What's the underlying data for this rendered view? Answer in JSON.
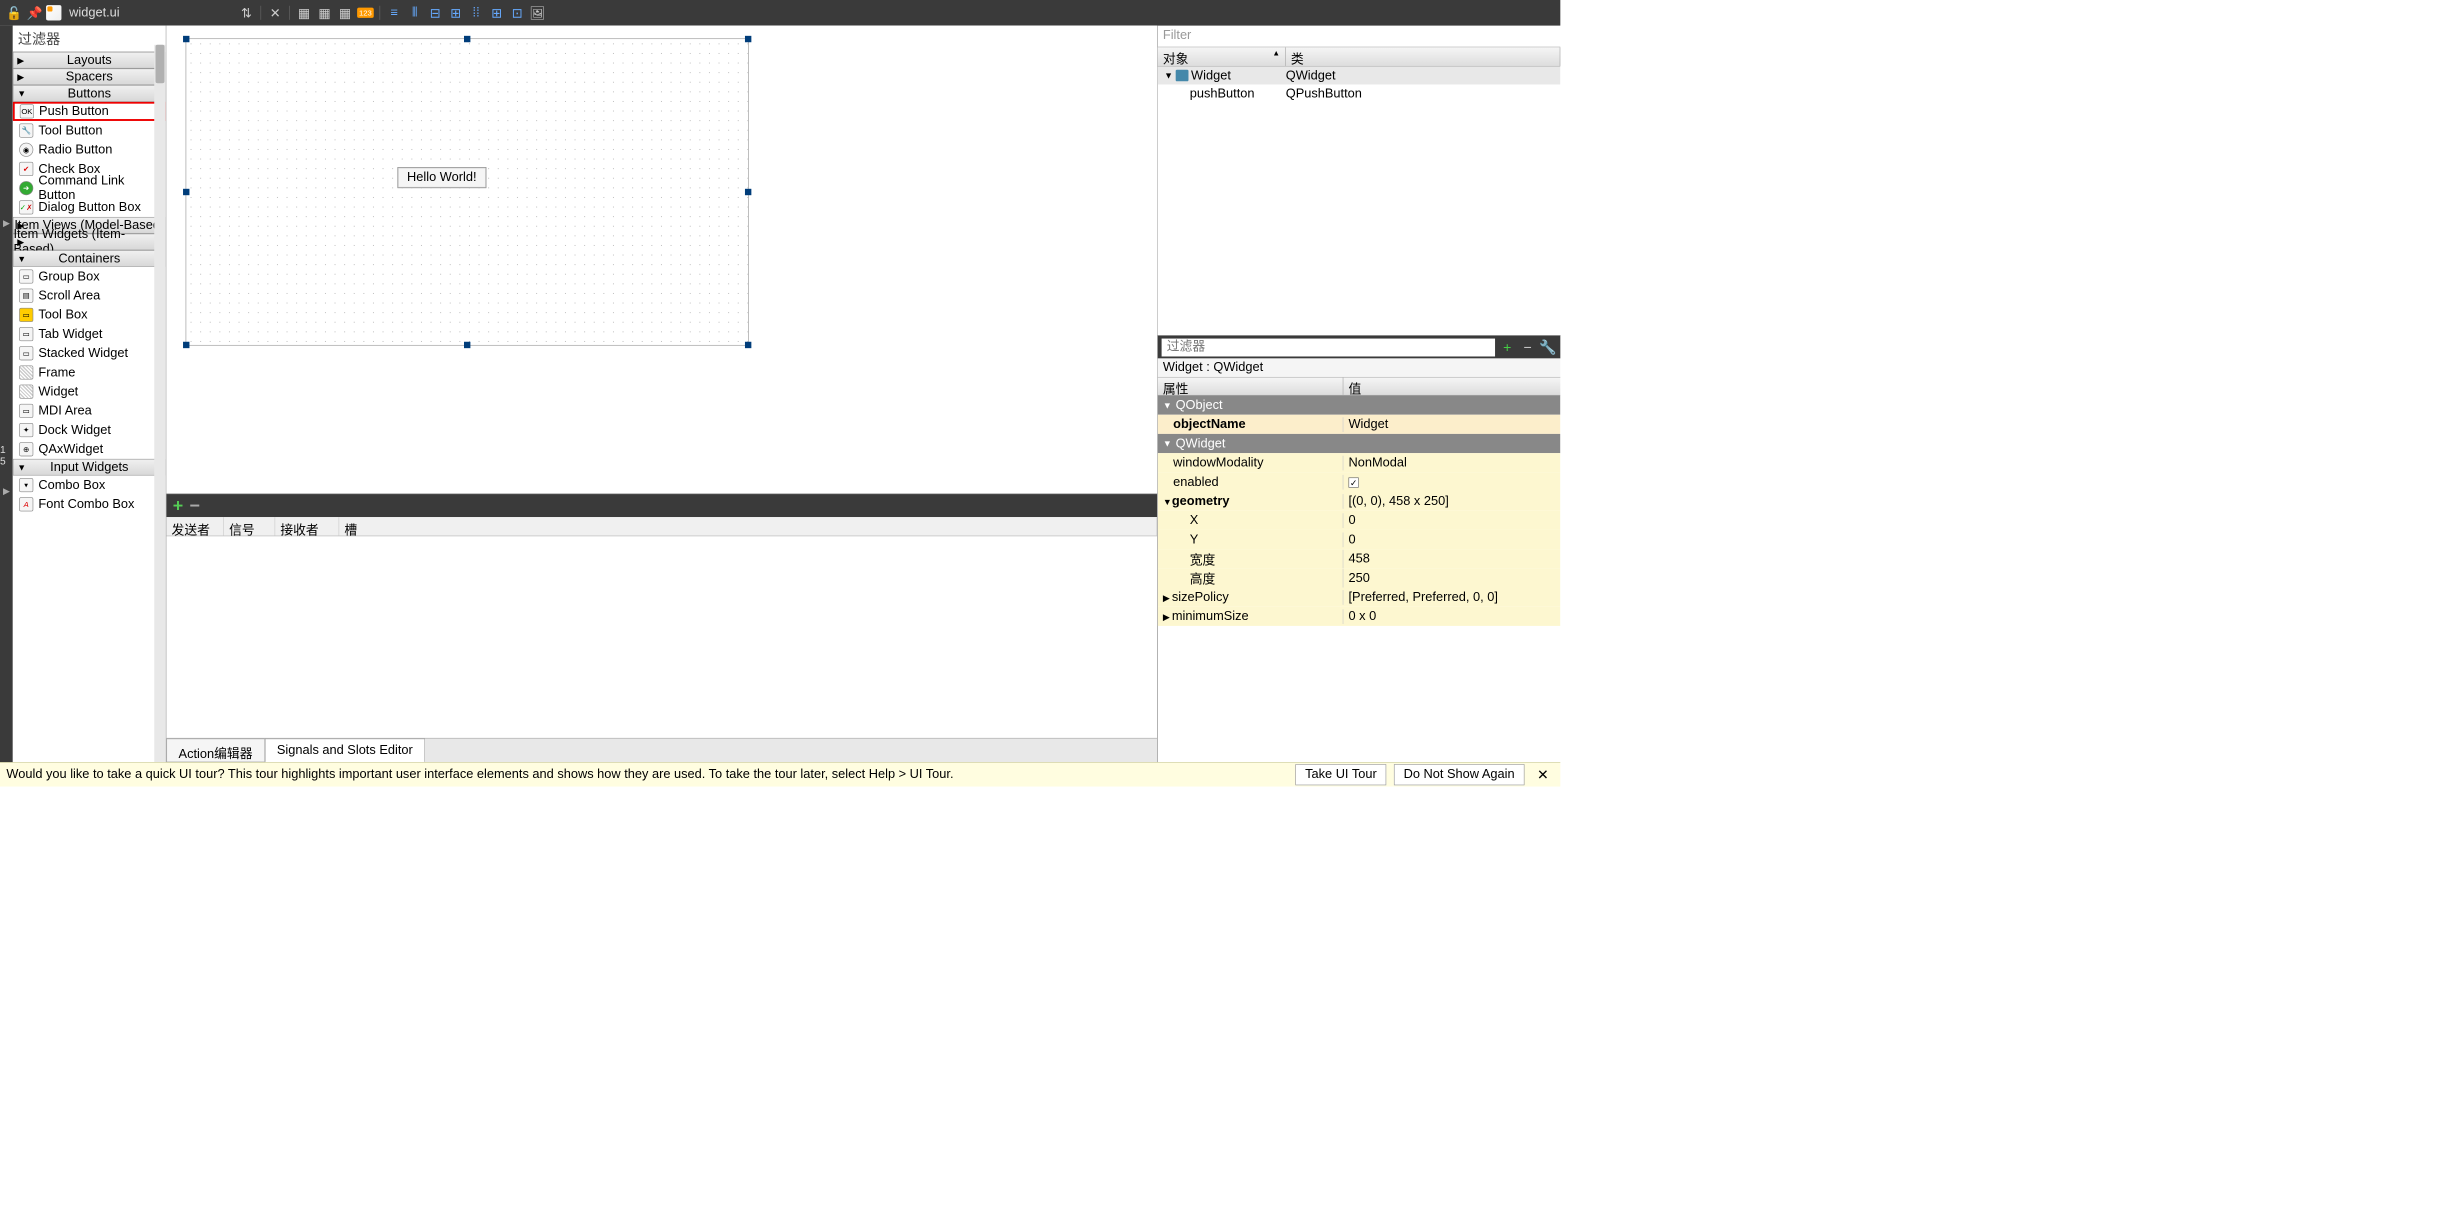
{
  "tab": {
    "title": "widget.ui"
  },
  "widgetbox": {
    "filter_label": "过滤器",
    "groups": {
      "layouts": "Layouts",
      "spacers": "Spacers",
      "buttons": "Buttons",
      "item_views": "Item Views (Model-Based)",
      "item_widgets": "Item Widgets (Item-Based)",
      "containers": "Containers",
      "input_widgets": "Input Widgets"
    },
    "buttons_items": {
      "push": "Push Button",
      "tool": "Tool Button",
      "radio": "Radio Button",
      "check": "Check Box",
      "cmdlink": "Command Link Button",
      "dialogbox": "Dialog Button Box"
    },
    "containers_items": {
      "groupbox": "Group Box",
      "scrollarea": "Scroll Area",
      "toolbox": "Tool Box",
      "tabwidget": "Tab Widget",
      "stacked": "Stacked Widget",
      "frame": "Frame",
      "widget": "Widget",
      "mdi": "MDI Area",
      "dock": "Dock Widget",
      "qax": "QAxWidget"
    },
    "input_items": {
      "combo": "Combo Box",
      "fontcombo": "Font Combo Box"
    }
  },
  "canvas": {
    "button_text": "Hello World!"
  },
  "signals_panel": {
    "cols": {
      "sender": "发送者",
      "signal": "信号",
      "receiver": "接收者",
      "slot": "槽"
    },
    "tabs": {
      "action": "Action编辑器",
      "signals": "Signals and Slots Editor"
    }
  },
  "leftstrip": {
    "num": "1 5"
  },
  "object_inspector": {
    "filter_placeholder": "Filter",
    "cols": {
      "object": "对象",
      "cls": "类"
    },
    "rows": [
      {
        "name": "Widget",
        "cls": "QWidget",
        "top": true
      },
      {
        "name": "pushButton",
        "cls": "QPushButton",
        "top": false
      }
    ]
  },
  "property_editor": {
    "filter_placeholder": "过滤器",
    "title": "Widget : QWidget",
    "cols": {
      "prop": "属性",
      "val": "值"
    },
    "sections": {
      "qobject": "QObject",
      "qwidget": "QWidget"
    },
    "rows": {
      "objectName": {
        "k": "objectName",
        "v": "Widget"
      },
      "windowModality": {
        "k": "windowModality",
        "v": "NonModal"
      },
      "enabled": {
        "k": "enabled",
        "v": "✓"
      },
      "geometry": {
        "k": "geometry",
        "v": "[(0, 0), 458 x 250]"
      },
      "x": {
        "k": "X",
        "v": "0"
      },
      "y": {
        "k": "Y",
        "v": "0"
      },
      "w": {
        "k": "宽度",
        "v": "458"
      },
      "h": {
        "k": "高度",
        "v": "250"
      },
      "sizePolicy": {
        "k": "sizePolicy",
        "v": "[Preferred, Preferred, 0, 0]"
      },
      "minimumSize": {
        "k": "minimumSize",
        "v": "0 x 0"
      }
    }
  },
  "statusbar": {
    "msg": "Would you like to take a quick UI tour? This tour highlights important user interface elements and shows how they are used. To take the tour later, select Help > UI Tour.",
    "take": "Take UI Tour",
    "dont": "Do Not Show Again"
  }
}
